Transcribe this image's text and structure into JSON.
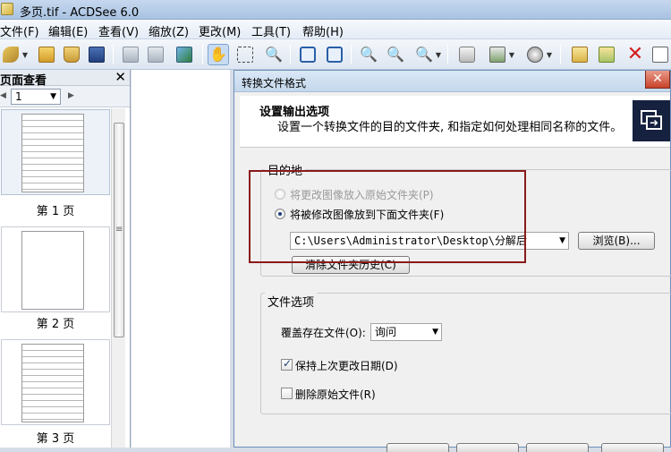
{
  "window": {
    "title": "多页.tif - ACDSee 6.0"
  },
  "menu": [
    "文件(F)",
    "编辑(E)",
    "查看(V)",
    "缩放(Z)",
    "更改(M)",
    "工具(T)",
    "帮助(H)"
  ],
  "left_panel": {
    "title": "页面查看",
    "page_select": "1",
    "pages": [
      {
        "caption": "第 1 页"
      },
      {
        "caption": "第 2 页"
      },
      {
        "caption": "第 3 页"
      }
    ]
  },
  "dialog": {
    "title": "转换文件格式",
    "header_title": "设置输出选项",
    "header_sub": "设置一个转换文件的目的文件夹, 和指定如何处理相同名称的文件。",
    "destination": {
      "group_label": "目的地",
      "option_original": "将更改图像放入原始文件夹(P)",
      "option_folder": "将被修改图像放到下面文件夹(F)",
      "folder_path": "C:\\Users\\Administrator\\Desktop\\分解后",
      "browse": "浏览(B)...",
      "clear_history": "清除文件夹历史(C)"
    },
    "file_options": {
      "group_label": "文件选项",
      "overwrite_label": "覆盖存在文件(O):",
      "overwrite_value": "询问",
      "keep_date": "保持上次更改日期(D)",
      "delete_original": "删除原始文件(R)"
    }
  },
  "colors": {
    "highlight": "#8a1a1a",
    "dialog_icon_bg": "#16213f"
  }
}
